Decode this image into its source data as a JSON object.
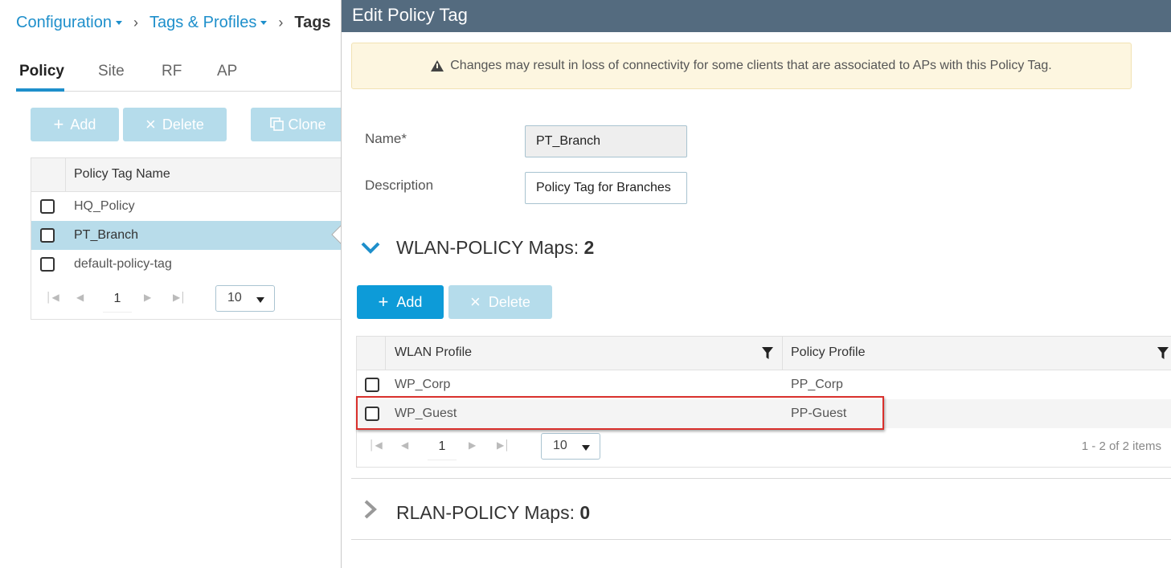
{
  "breadcrumb": {
    "items": [
      "Configuration",
      "Tags & Profiles"
    ],
    "current": "Tags"
  },
  "tabs": [
    "Policy",
    "Site",
    "RF",
    "AP"
  ],
  "left_toolbar": {
    "add_label": "Add",
    "delete_label": "Delete",
    "clone_label": "Clone"
  },
  "policy_table": {
    "header": "Policy Tag Name",
    "rows": [
      "HQ_Policy",
      "PT_Branch",
      "default-policy-tag"
    ],
    "selected_row": "PT_Branch",
    "page": "1",
    "page_size": "10"
  },
  "panel": {
    "title": "Edit Policy Tag",
    "warning": "Changes may result in loss of connectivity for some clients that are associated to APs with this Policy Tag.",
    "name_label": "Name*",
    "name_value": "PT_Branch",
    "description_label": "Description",
    "description_value": "Policy Tag for Branches",
    "wlan_section": {
      "label": "WLAN-POLICY Maps:",
      "count": "2",
      "add_label": "Add",
      "delete_label": "Delete",
      "col_wlan": "WLAN Profile",
      "col_policy": "Policy Profile",
      "rows": [
        {
          "wlan": "WP_Corp",
          "policy": "PP_Corp"
        },
        {
          "wlan": "WP_Guest",
          "policy": "PP-Guest"
        }
      ],
      "page": "1",
      "page_size": "10",
      "items_count": "1 - 2 of 2 items"
    },
    "rlan_section": {
      "label": "RLAN-POLICY Maps:",
      "count": "0"
    }
  },
  "colors": {
    "header_bg": "#546b7f",
    "accent": "#1e8fcb",
    "primary_button": "#0d9bd8",
    "disabled_button": "#b5dceb",
    "selected_row": "#b8dcea",
    "highlight_border": "#d9302c",
    "warning_bg": "#fdf6e0"
  }
}
